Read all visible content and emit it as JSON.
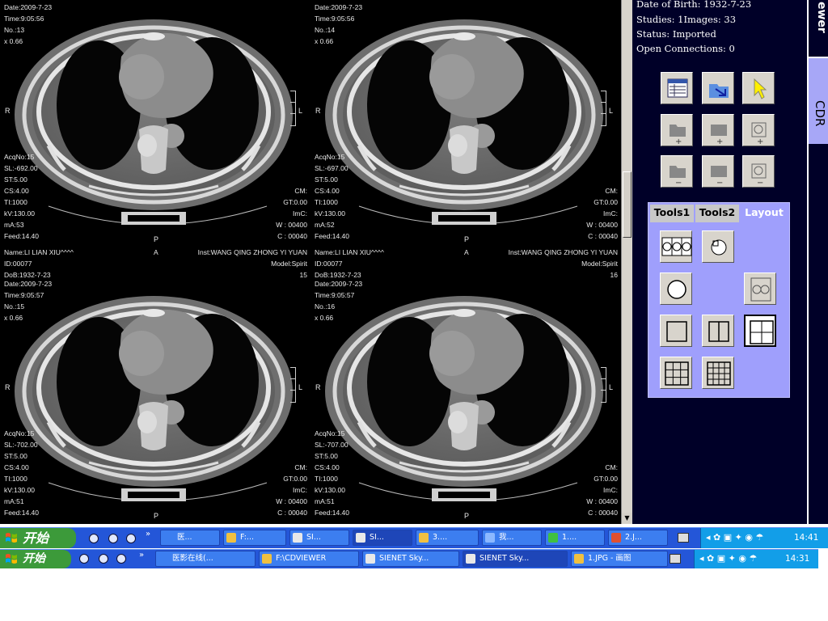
{
  "viewports": [
    {
      "id": "1",
      "date": "Date:2009-7-23",
      "time": "Time:9:05:56",
      "no": "No.:13",
      "zoom": "x 0.66",
      "acqno": "AcqNo:15",
      "sl": "SL:-692.00",
      "st": "ST:5.00",
      "cs": "CS:4.00",
      "ti": "TI:1000",
      "kv": "kV:130.00",
      "ma": "mA:53",
      "feed": "Feed:14.40",
      "cm": "CM:",
      "gt": "GT:0.00",
      "imc": "ImC:",
      "w": "W : 00400",
      "c": "C : 00040",
      "left_marker": "R",
      "right_marker": "L",
      "bottom_marker": "P",
      "top_marker": "",
      "name": "",
      "inst": "",
      "id_field": "",
      "model": "",
      "dob": "",
      "series": ""
    },
    {
      "id": "2",
      "date": "Date:2009-7-23",
      "time": "Time:9:05:56",
      "no": "No.:14",
      "zoom": "x 0.66",
      "acqno": "AcqNo:15",
      "sl": "SL:-697.00",
      "st": "ST:5.00",
      "cs": "CS:4.00",
      "ti": "TI:1000",
      "kv": "kV:130.00",
      "ma": "mA:52",
      "feed": "Feed:14.40",
      "cm": "CM:",
      "gt": "GT:0.00",
      "imc": "ImC:",
      "w": "W : 00400",
      "c": "C : 00040",
      "left_marker": "R",
      "right_marker": "L",
      "bottom_marker": "P",
      "top_marker": "",
      "name": "",
      "inst": "",
      "id_field": "",
      "model": "",
      "dob": "",
      "series": ""
    },
    {
      "id": "3",
      "name": "Name:LI LIAN XIU^^^^",
      "top_marker": "A",
      "inst": "Inst:WANG QING ZHONG YI YUAN",
      "id_field": "ID:00077",
      "model": "Model:Spirit",
      "dob": "DoB:1932-7-23",
      "series": "15",
      "date": "Date:2009-7-23",
      "time": "Time:9:05:57",
      "no": "No.:15",
      "zoom": "x 0.66",
      "acqno": "AcqNo:15",
      "sl": "SL:-702.00",
      "st": "ST:5.00",
      "cs": "CS:4.00",
      "ti": "TI:1000",
      "kv": "kV:130.00",
      "ma": "mA:51",
      "feed": "Feed:14.40",
      "cm": "CM:",
      "gt": "GT:0.00",
      "imc": "ImC:",
      "w": "W : 00400",
      "c": "C : 00040",
      "left_marker": "R",
      "right_marker": "L",
      "bottom_marker": "P"
    },
    {
      "id": "4",
      "name": "Name:LI LIAN XIU^^^^",
      "top_marker": "A",
      "inst": "Inst:WANG QING ZHONG YI YUAN",
      "id_field": "ID:00077",
      "model": "Model:Spirit",
      "dob": "DoB:1932-7-23",
      "series": "16",
      "date": "Date:2009-7-23",
      "time": "Time:9:05:57",
      "no": "No.:16",
      "zoom": "x 0.66",
      "acqno": "AcqNo:15",
      "sl": "SL:-707.00",
      "st": "ST:5.00",
      "cs": "CS:4.00",
      "ti": "TI:1000",
      "kv": "kV:130.00",
      "ma": "mA:51",
      "feed": "Feed:14.40",
      "cm": "CM:",
      "gt": "GT:0.00",
      "imc": "ImC:",
      "w": "W : 00400",
      "c": "C : 00040",
      "left_marker": "R",
      "right_marker": "L",
      "bottom_marker": "P"
    }
  ],
  "scrollbar": {
    "up_icon": "triangle-up",
    "down_icon": "triangle-down",
    "down_arrow": "▼"
  },
  "panel": {
    "date_of_birth": "Date of Birth: 1932-7-23",
    "studies_images": "Studies: 1Images: 33",
    "status": "Status: Imported",
    "open_connections": "Open Connections: 0",
    "sidebar_title": "ewer",
    "sidebar_tab": "CDR",
    "tools": [
      {
        "name": "table-icon"
      },
      {
        "name": "open-folder-icon"
      },
      {
        "name": "pointer-icon"
      },
      {
        "name": "add-folder-icon"
      },
      {
        "name": "add-series-icon"
      },
      {
        "name": "add-image-icon"
      },
      {
        "name": "remove-folder-icon"
      },
      {
        "name": "remove-series-icon"
      },
      {
        "name": "remove-image-icon"
      }
    ],
    "tabs": [
      "Tools1",
      "Tools2",
      "Layout"
    ],
    "active_tab": "Layout",
    "layout_buttons": [
      {
        "name": "layout-compare-heads",
        "selected": false
      },
      {
        "name": "layout-head-small",
        "selected": false
      },
      {
        "name": "layout-head-single",
        "selected": false
      },
      {
        "name": "layout-head-double",
        "selected": false
      },
      {
        "name": "layout-1x1",
        "selected": false
      },
      {
        "name": "layout-1x2",
        "selected": false
      },
      {
        "name": "layout-2x2",
        "selected": true
      },
      {
        "name": "layout-3x3",
        "selected": false
      },
      {
        "name": "layout-4x4",
        "selected": false
      }
    ],
    "accent": "#9f9ffc"
  },
  "taskbar1": {
    "start_label": "开始",
    "items": [
      "医...",
      "F:...",
      "SI...",
      "SI...",
      "3....",
      "我...",
      "1....",
      "2.J..."
    ],
    "active_index": 3,
    "clock": "14:41"
  },
  "taskbar2": {
    "start_label": "开始",
    "items": [
      "医影在线(...",
      "F:\\CDVIEWER",
      "SIENET Sky...",
      "SIENET Sky...",
      "1.JPG - 画图"
    ],
    "active_index": 3,
    "clock": "14:31"
  },
  "colors": {
    "taskbar_blue": "#2456d8",
    "start_green": "#3c9a3a",
    "panel_bg": "#000028"
  }
}
